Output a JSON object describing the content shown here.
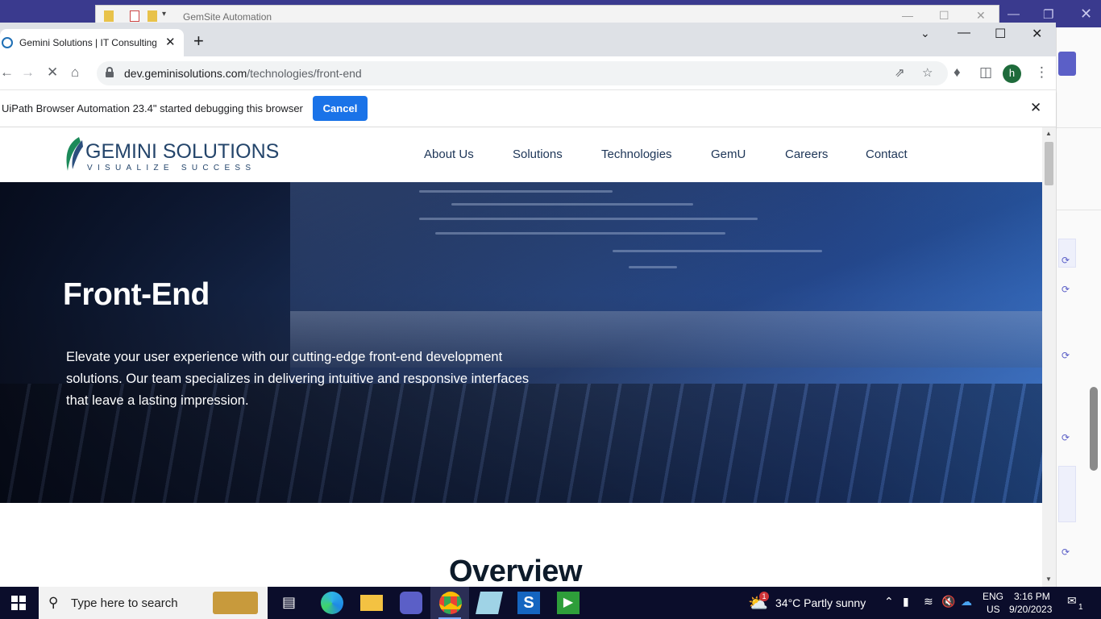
{
  "background_window": {
    "title": "GemSite Automation"
  },
  "browser": {
    "tab_title": "Gemini Solutions | IT Consulting",
    "url_host": "dev.geminisolutions.com",
    "url_path": "/technologies/front-end",
    "profile_initial": "h"
  },
  "infobar": {
    "message": "UiPath Browser Automation 23.4\" started debugging this browser",
    "cancel_label": "Cancel"
  },
  "site": {
    "logo_main": "GEMINI SOLUTIONS",
    "logo_tagline": "VISUALIZE SUCCESS",
    "nav": [
      "About Us",
      "Solutions",
      "Technologies",
      "GemU",
      "Careers",
      "Contact"
    ],
    "hero_title": "Front-End",
    "hero_description": "Elevate your user experience with our cutting-edge front-end development solutions. Our team specializes in delivering intuitive and responsive interfaces that leave a lasting impression.",
    "section_heading": "Overview"
  },
  "taskbar": {
    "search_placeholder": "Type here to search",
    "weather": "34°C  Partly sunny",
    "weather_badge": "1",
    "language": "ENG",
    "region": "US",
    "time": "3:16 PM",
    "date": "9/20/2023",
    "notification_count": "1"
  },
  "colors": {
    "accent": "#1a73e8",
    "brand_navy": "#24456b",
    "taskbar": "#0b0d2b"
  }
}
